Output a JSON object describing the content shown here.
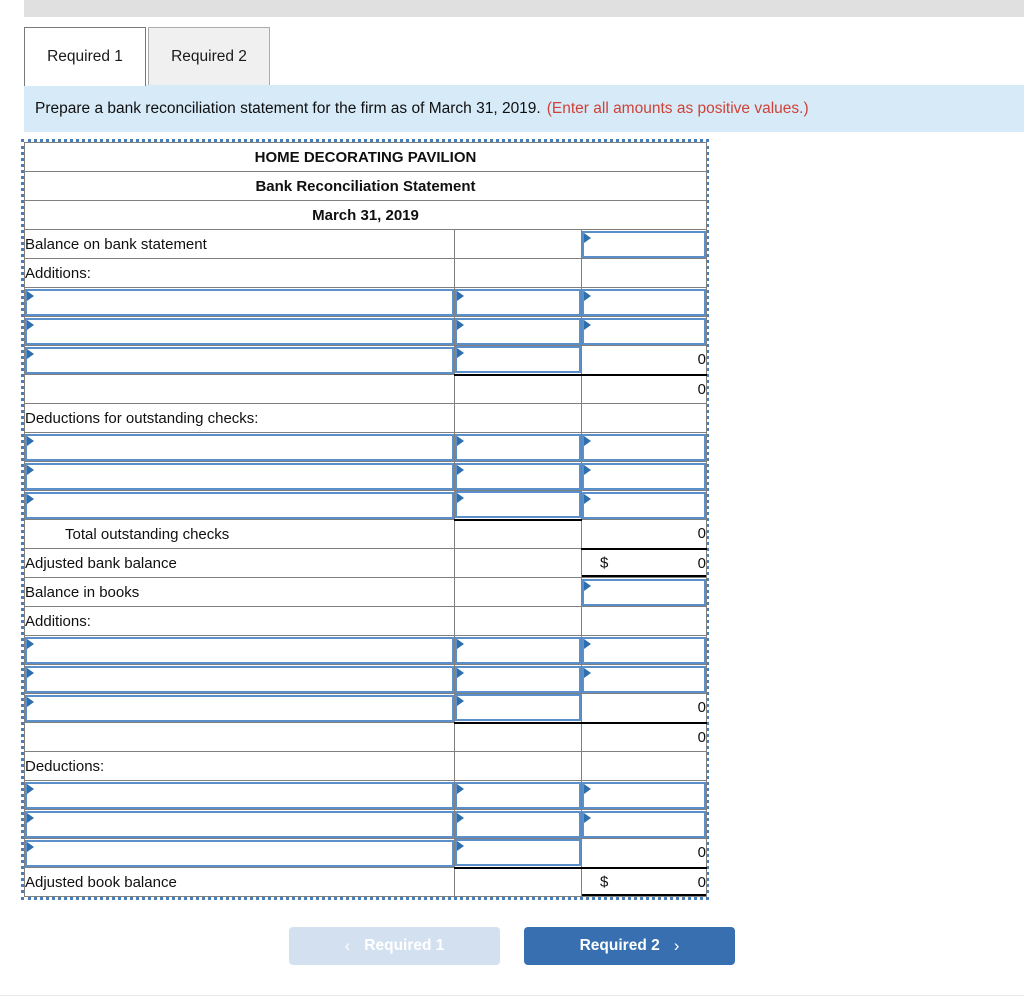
{
  "tabs": [
    {
      "label": "Required 1",
      "active": true
    },
    {
      "label": "Required 2",
      "active": false
    }
  ],
  "instruction": {
    "text": "Prepare a bank reconciliation statement for the firm as of March 31, 2019.",
    "hint": "(Enter all amounts as positive values.)"
  },
  "worksheet": {
    "title_line1": "HOME DECORATING PAVILION",
    "title_line2": "Bank Reconciliation Statement",
    "title_line3": "March 31, 2019",
    "rows": [
      {
        "label": "Balance on bank statement",
        "mid": "",
        "right": ""
      },
      {
        "label": "Additions:",
        "mid": "",
        "right": ""
      },
      {
        "label": "",
        "mid": "",
        "right": ""
      },
      {
        "label": "",
        "mid": "",
        "right": ""
      },
      {
        "label": "",
        "mid": "",
        "right": "0"
      },
      {
        "label": "",
        "mid": "",
        "right": "0"
      },
      {
        "label": "Deductions for outstanding checks:",
        "mid": "",
        "right": ""
      },
      {
        "label": "",
        "mid": "",
        "right": ""
      },
      {
        "label": "",
        "mid": "",
        "right": ""
      },
      {
        "label": "",
        "mid": "",
        "right": ""
      },
      {
        "label": "Total outstanding checks",
        "mid": "",
        "right": "0"
      },
      {
        "label": "Adjusted bank balance",
        "mid": "",
        "right": "0",
        "symbol": "$"
      },
      {
        "label": "Balance in books",
        "mid": "",
        "right": ""
      },
      {
        "label": "Additions:",
        "mid": "",
        "right": ""
      },
      {
        "label": "",
        "mid": "",
        "right": ""
      },
      {
        "label": "",
        "mid": "",
        "right": ""
      },
      {
        "label": "",
        "mid": "",
        "right": "0"
      },
      {
        "label": "",
        "mid": "",
        "right": "0"
      },
      {
        "label": "Deductions:",
        "mid": "",
        "right": ""
      },
      {
        "label": "",
        "mid": "",
        "right": ""
      },
      {
        "label": "",
        "mid": "",
        "right": ""
      },
      {
        "label": "",
        "mid": "",
        "right": "0"
      },
      {
        "label": "Adjusted book balance",
        "mid": "",
        "right": "0",
        "symbol": "$"
      }
    ]
  },
  "nav": {
    "prev_label": "Required 1",
    "next_label": "Required 2",
    "prev_chevron": "‹",
    "next_chevron": "›"
  },
  "colors": {
    "header_blue": "#74abe6",
    "banner_blue": "#d6eaf8",
    "hint_red": "#d04237",
    "button_blue": "#376fb0",
    "button_disabled": "#d3e0f0",
    "input_border": "#5b8fc9"
  }
}
